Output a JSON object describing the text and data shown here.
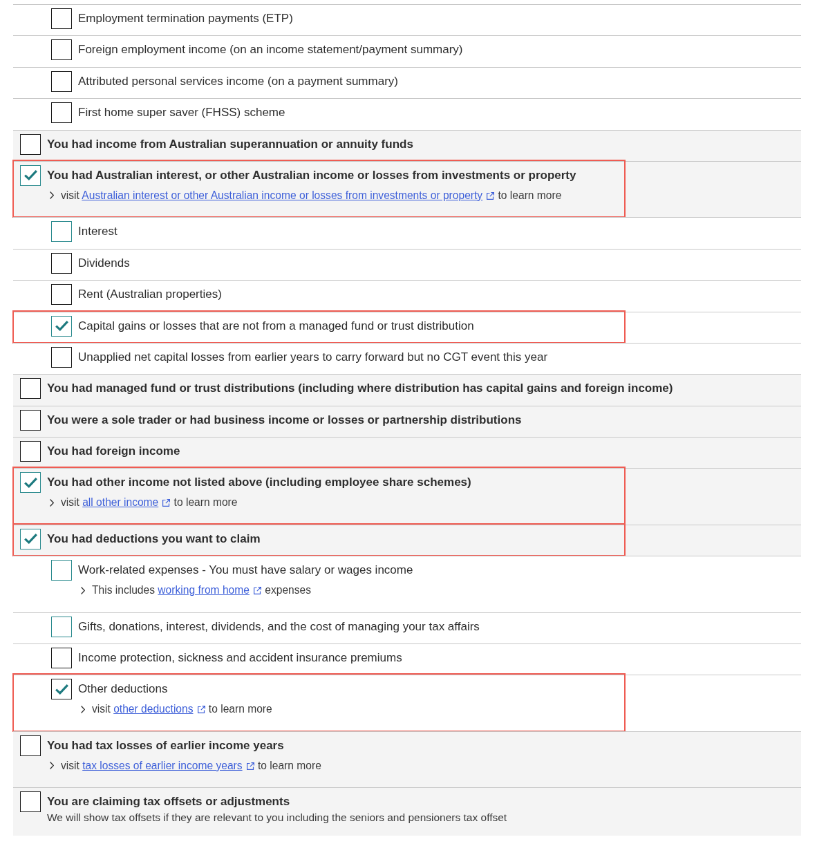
{
  "continued_options": [
    {
      "label": "Employment termination payments (ETP)",
      "checked": false,
      "color": "#1a1a1a",
      "highlighted": false
    },
    {
      "label": "Foreign employment income (on an income statement/payment summary)",
      "checked": false,
      "color": "#1a1a1a",
      "highlighted": false
    },
    {
      "label": "Attributed personal services income (on a payment summary)",
      "checked": false,
      "color": "#1a1a1a",
      "highlighted": false
    },
    {
      "label": "First home super saver (FHSS) scheme",
      "checked": false,
      "color": "#1a1a1a",
      "highlighted": false
    }
  ],
  "groups": [
    {
      "label": "You had income from Australian superannuation or annuity funds",
      "checked": false,
      "color": "#1a1a1a",
      "highlighted": false
    },
    {
      "label": "You had Australian interest, or other Australian income or losses from investments or property",
      "checked": true,
      "color": "#2a8a8e",
      "highlighted": true,
      "note": {
        "lead": "visit",
        "link": "Australian interest or other Australian income or losses from investments or property",
        "trail": "to learn more"
      },
      "children": [
        {
          "label": "Interest",
          "checked": false,
          "color": "#2a8a8e",
          "highlighted": false
        },
        {
          "label": "Dividends",
          "checked": false,
          "color": "#1a1a1a",
          "highlighted": false
        },
        {
          "label": "Rent (Australian properties)",
          "checked": false,
          "color": "#1a1a1a",
          "highlighted": false
        },
        {
          "label": "Capital gains or losses that are not from a managed fund or trust distribution",
          "checked": true,
          "color": "#2a8a8e",
          "highlighted": true
        },
        {
          "label": "Unapplied net capital losses from earlier years to carry forward but no CGT event this year",
          "checked": false,
          "color": "#1a1a1a",
          "highlighted": false
        }
      ]
    },
    {
      "label": "You had managed fund or trust distributions (including where distribution has capital gains and foreign income)",
      "checked": false,
      "color": "#1a1a1a",
      "highlighted": false
    },
    {
      "label": "You were a sole trader or had business income or losses or partnership distributions",
      "checked": false,
      "color": "#1a1a1a",
      "highlighted": false
    },
    {
      "label": "You had foreign income",
      "checked": false,
      "color": "#1a1a1a",
      "highlighted": false
    },
    {
      "label": "You had other income not listed above (including employee share schemes)",
      "checked": true,
      "color": "#2a8a8e",
      "highlighted": true,
      "note": {
        "lead": "visit",
        "link": "all other income",
        "trail": "to learn more"
      }
    },
    {
      "label": "You had deductions you want to claim",
      "checked": true,
      "color": "#2a8a8e",
      "highlighted": true,
      "children": [
        {
          "label": "Work-related expenses - You must have salary or wages income",
          "checked": false,
          "color": "#2a8a8e",
          "highlighted": false,
          "note": {
            "lead": "This includes",
            "link": "working from home",
            "trail": "expenses"
          }
        },
        {
          "label": "Gifts, donations, interest, dividends, and the cost of managing your tax affairs",
          "checked": false,
          "color": "#2a8a8e",
          "highlighted": false
        },
        {
          "label": "Income protection, sickness and accident insurance premiums",
          "checked": false,
          "color": "#1a1a1a",
          "highlighted": false
        },
        {
          "label": "Other deductions",
          "checked": true,
          "color": "#1a1a1a",
          "highlighted": true,
          "note": {
            "lead": "visit",
            "link": "other deductions",
            "trail": "to learn more"
          }
        }
      ]
    },
    {
      "label": "You had tax losses of earlier income years",
      "checked": false,
      "color": "#1a1a1a",
      "highlighted": false,
      "note": {
        "lead": "visit",
        "link": "tax losses of earlier income years",
        "trail": "to learn more"
      }
    },
    {
      "label": "You are claiming tax offsets or adjustments",
      "checked": false,
      "color": "#1a1a1a",
      "highlighted": false,
      "description": "We will show tax offsets if they are relevant to you including the seniors and pensioners tax offset"
    }
  ]
}
